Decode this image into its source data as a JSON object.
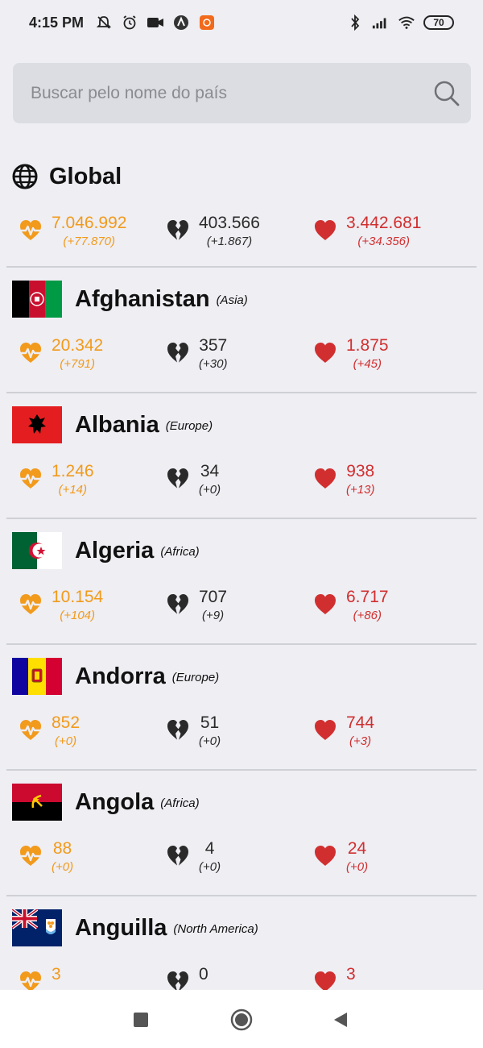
{
  "status_bar": {
    "time": "4:15 PM",
    "battery": "70",
    "icons": [
      "silent-icon",
      "alarm-icon",
      "video-icon",
      "app-icon",
      "app-badge-icon",
      "bluetooth-icon",
      "signal-icon",
      "wifi-icon"
    ]
  },
  "search": {
    "placeholder": "Buscar pelo nome do país"
  },
  "colors": {
    "cases": "#f29a1b",
    "deaths": "#2a2a2a",
    "recovered": "#d12f2f"
  },
  "global": {
    "name": "Global",
    "cases": "7.046.992",
    "cases_delta": "(+77.870)",
    "deaths": "403.566",
    "deaths_delta": "(+1.867)",
    "recovered": "3.442.681",
    "recovered_delta": "(+34.356)"
  },
  "countries": [
    {
      "name": "Afghanistan",
      "continent": "(Asia)",
      "cases": "20.342",
      "cases_delta": "(+791)",
      "deaths": "357",
      "deaths_delta": "(+30)",
      "recovered": "1.875",
      "recovered_delta": "(+45)"
    },
    {
      "name": "Albania",
      "continent": "(Europe)",
      "cases": "1.246",
      "cases_delta": "(+14)",
      "deaths": "34",
      "deaths_delta": "(+0)",
      "recovered": "938",
      "recovered_delta": "(+13)"
    },
    {
      "name": "Algeria",
      "continent": "(Africa)",
      "cases": "10.154",
      "cases_delta": "(+104)",
      "deaths": "707",
      "deaths_delta": "(+9)",
      "recovered": "6.717",
      "recovered_delta": "(+86)"
    },
    {
      "name": "Andorra",
      "continent": "(Europe)",
      "cases": "852",
      "cases_delta": "(+0)",
      "deaths": "51",
      "deaths_delta": "(+0)",
      "recovered": "744",
      "recovered_delta": "(+3)"
    },
    {
      "name": "Angola",
      "continent": "(Africa)",
      "cases": "88",
      "cases_delta": "(+0)",
      "deaths": "4",
      "deaths_delta": "(+0)",
      "recovered": "24",
      "recovered_delta": "(+0)"
    },
    {
      "name": "Anguilla",
      "continent": "(North America)",
      "cases": "3",
      "cases_delta": "",
      "deaths": "0",
      "deaths_delta": "",
      "recovered": "3",
      "recovered_delta": ""
    }
  ],
  "nav": {
    "buttons": [
      "recent-apps-icon",
      "home-icon",
      "back-icon"
    ]
  }
}
